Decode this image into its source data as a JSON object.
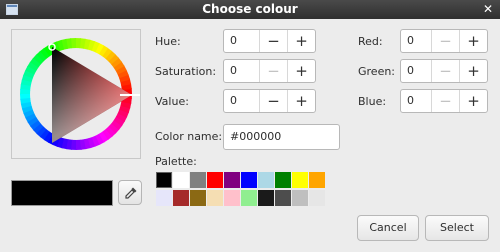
{
  "window": {
    "title": "Choose colour"
  },
  "fields": {
    "hue": {
      "label": "Hue:",
      "value": "0"
    },
    "saturation": {
      "label": "Saturation:",
      "value": "0"
    },
    "value": {
      "label": "Value:",
      "value": "0"
    },
    "red": {
      "label": "Red:",
      "value": "0"
    },
    "green": {
      "label": "Green:",
      "value": "0"
    },
    "blue": {
      "label": "Blue:",
      "value": "0"
    }
  },
  "spin_symbols": {
    "minus": "−",
    "plus": "+"
  },
  "color_name": {
    "label": "Color name:",
    "value": "#000000"
  },
  "palette": {
    "label": "Palette:",
    "row1": [
      "#000000",
      "#ffffff",
      "#808080",
      "#ff0000",
      "#800080",
      "#0000ff",
      "#add8e6",
      "#008000",
      "#ffff00",
      "#ffa500"
    ],
    "row2": [
      "#e6e6fa",
      "#a52a2a",
      "#8b6914",
      "#f5deb3",
      "#ffc0cb",
      "#90ee90",
      "#1a1a1a",
      "#4d4d4d",
      "#bfbfbf",
      "#e6e6e6"
    ]
  },
  "current_color": "#000000",
  "icons": {
    "window": "window-icon",
    "close": "close-icon",
    "picker": "eyedropper-icon"
  },
  "buttons": {
    "cancel": "Cancel",
    "select": "Select"
  }
}
